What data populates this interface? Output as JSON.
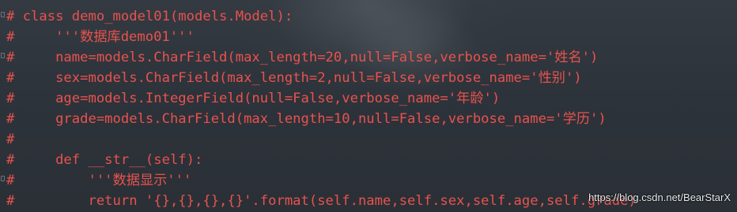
{
  "editor": {
    "lines": [
      "# class demo_model01(models.Model):",
      "#     '''数据库demo01'''",
      "#     name=models.CharField(max_length=20,null=False,verbose_name='姓名')",
      "#     sex=models.CharField(max_length=2,null=False,verbose_name='性别')",
      "#     age=models.IntegerField(null=False,verbose_name='年龄')",
      "#     grade=models.CharField(max_length=10,null=False,verbose_name='学历')",
      "#",
      "#     def __str__(self):",
      "#         '''数据显示'''",
      "#         return '{},{},{},{}'.format(self.name,self.sex,self.age,self.grade)"
    ],
    "comment_color": "#e8524f",
    "background_color": "#2c3239"
  },
  "watermark": {
    "text": "https://blog.csdn.net/BearStarX"
  }
}
